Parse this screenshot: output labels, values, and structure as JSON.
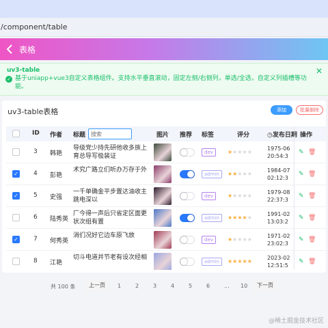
{
  "browser": {
    "url": "/component/table"
  },
  "navbar": {
    "title": "表格",
    "back_icon": "chevron-left-icon"
  },
  "alert": {
    "title": "uv3-table",
    "description": "基于uniapp+vue3自定义表格组件。支持水平垂直滚动，固定左侧/右侧列，单选/全选，自定义列插槽等功能。",
    "icon": "check-circle-icon"
  },
  "card": {
    "title": "uv3-table表格",
    "add_label": "添加",
    "batch_delete_label": "批量删除"
  },
  "table": {
    "columns": {
      "id": "ID",
      "author": "作者",
      "title": "标题",
      "image": "图片",
      "recommend": "推荐",
      "tag": "标签",
      "rating": "评分",
      "date": "发布日期",
      "action": "操作"
    },
    "search_placeholder": "搜索",
    "rows": [
      {
        "checked": false,
        "id": "3",
        "author": "韩艳",
        "title": "导级党少持先研他收多族上育总导写极装证",
        "recommend": false,
        "tag": "dev",
        "rating": 1,
        "date": "1975-06",
        "time": "20:54:3"
      },
      {
        "checked": true,
        "id": "4",
        "author": "彭艳",
        "title": "术究广路立们听办万存于外",
        "recommend": true,
        "tag": "admin",
        "rating": 2,
        "date": "1984-07",
        "time": "02:12:3"
      },
      {
        "checked": true,
        "id": "5",
        "author": "史强",
        "title": "一千单确金平步置达油收主跳电深以",
        "recommend": false,
        "tag": "dev",
        "rating": 1,
        "date": "1979-08",
        "time": "22:37:3"
      },
      {
        "checked": false,
        "id": "6",
        "author": "陆秀英",
        "title": "厂今得一声后只省定区面更状次组有置",
        "recommend": true,
        "tag": "admin",
        "rating": 4,
        "date": "1991-02",
        "time": "13:03:2"
      },
      {
        "checked": true,
        "id": "7",
        "author": "何秀英",
        "title": "消们况好它边车原飞放",
        "recommend": false,
        "tag": "dev",
        "rating": 1,
        "date": "1971-02",
        "time": "23:02:3"
      },
      {
        "checked": false,
        "id": "8",
        "author": "江艳",
        "title": "切斗电道并节老有设次经相",
        "recommend": false,
        "tag": "admin",
        "rating": 5,
        "date": "2023-02",
        "time": "12:51:5"
      }
    ],
    "tag_colors": {
      "dev": "#b37feb",
      "admin": "#a6a9f2"
    },
    "pic_colors": [
      "#3b4a3a",
      "#8a3b6a",
      "#2c1c2c",
      "#4a78c8",
      "#a23a52",
      "#9aa6e0"
    ]
  },
  "pager": {
    "total": "共 100 条",
    "prev": "上一页",
    "next": "下一页",
    "pages": [
      "1",
      "2",
      "3",
      "4",
      "5",
      "6",
      "...",
      "10"
    ]
  },
  "watermark": "@稀土掘金技术社区"
}
